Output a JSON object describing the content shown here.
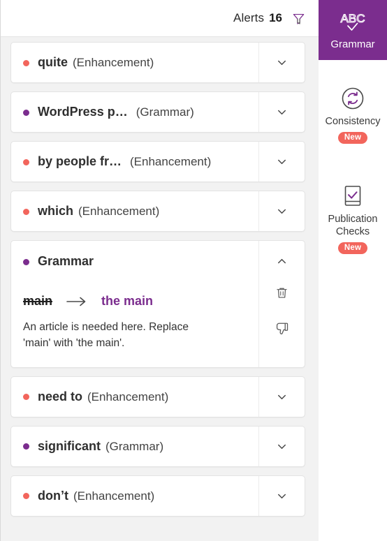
{
  "header": {
    "alerts_label": "Alerts",
    "alerts_count": "16",
    "filter_icon": "filter-funnel-icon"
  },
  "colors": {
    "brand_purple": "#7b2d8e",
    "enhancement_red": "#f2655c",
    "page_background": "#f2f2f2",
    "card_background": "#ffffff"
  },
  "alerts": [
    {
      "term": "quite",
      "category": "(Enhancement)",
      "type": "enhancement",
      "expanded": false,
      "chevron": "chevron-down-icon"
    },
    {
      "term": "WordPress p…",
      "category": "(Grammar)",
      "type": "grammar",
      "expanded": false,
      "chevron": "chevron-down-icon"
    },
    {
      "term": "by people fr…",
      "category": "(Enhancement)",
      "type": "enhancement",
      "expanded": false,
      "chevron": "chevron-down-icon"
    },
    {
      "term": "which",
      "category": "(Enhancement)",
      "type": "enhancement",
      "expanded": false,
      "chevron": "chevron-down-icon"
    },
    {
      "term": "Grammar",
      "category": "",
      "type": "grammar",
      "expanded": true,
      "chevron": "chevron-up-icon",
      "suggestion": {
        "original": "main",
        "arrow": "arrow-right-icon",
        "replacement": "the main",
        "explanation": "An article is needed here. Replace 'main' with 'the main'.",
        "delete_icon": "trash-icon",
        "dislike_icon": "thumbs-down-icon"
      }
    },
    {
      "term": "need to",
      "category": "(Enhancement)",
      "type": "enhancement",
      "expanded": false,
      "chevron": "chevron-down-icon"
    },
    {
      "term": "significant",
      "category": "(Grammar)",
      "type": "grammar",
      "expanded": false,
      "chevron": "chevron-down-icon"
    },
    {
      "term": "don’t",
      "category": "(Enhancement)",
      "type": "enhancement",
      "expanded": false,
      "chevron": "chevron-down-icon"
    }
  ],
  "sidebar": {
    "items": [
      {
        "label": "Grammar",
        "icon": "abc-check-icon",
        "icon_text": "ABC",
        "active": true,
        "badge": ""
      },
      {
        "label": "Consistency",
        "icon": "sync-circle-icon",
        "active": false,
        "badge": "New"
      },
      {
        "label": "Publication Checks",
        "icon": "book-check-icon",
        "active": false,
        "badge": "New"
      }
    ]
  }
}
